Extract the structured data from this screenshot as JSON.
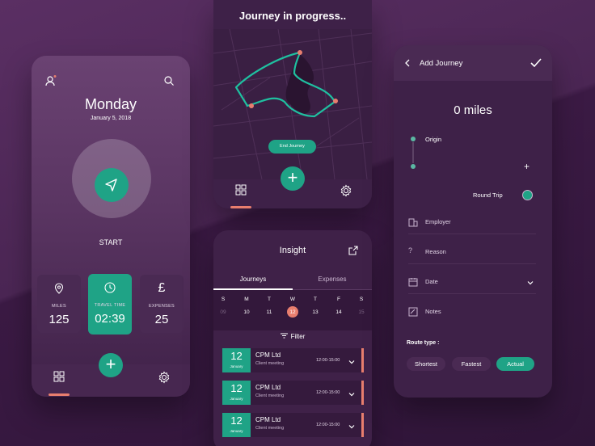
{
  "colors": {
    "accent": "#1fa386",
    "highlight": "#e87e6e",
    "background": "#3a1a42"
  },
  "home": {
    "day": "Monday",
    "date": "January 5, 2018",
    "start_label": "START",
    "stats": [
      {
        "label": "MILES",
        "value": "125",
        "icon": "location-pin-icon"
      },
      {
        "label": "TRAVEL TIME",
        "value": "02:39",
        "icon": "clock-icon"
      },
      {
        "label": "EXPENSES",
        "value": "25",
        "icon": "pound-icon"
      }
    ],
    "add_label": "+"
  },
  "journey": {
    "title": "Journey in progress..",
    "end_button": "End Journey",
    "add_label": "+"
  },
  "insight": {
    "title": "Insight",
    "tabs": [
      "Journeys",
      "Expenses"
    ],
    "day_letters": [
      "S",
      "M",
      "T",
      "W",
      "T",
      "F",
      "S"
    ],
    "day_numbers": [
      "09",
      "10",
      "11",
      "12",
      "13",
      "14",
      "15"
    ],
    "selected_day_index": 3,
    "filter_label": "Filter",
    "trips": [
      {
        "day": "12",
        "month": "January",
        "name": "CPM Ltd",
        "subtitle": "Client meeting",
        "time": "12:00-15:00"
      },
      {
        "day": "12",
        "month": "January",
        "name": "CPM Ltd",
        "subtitle": "Client meeting",
        "time": "12:00-15:00"
      },
      {
        "day": "12",
        "month": "January",
        "name": "CPM Ltd",
        "subtitle": "Client meeting",
        "time": "12:00-15:00"
      }
    ]
  },
  "add_journey": {
    "title": "Add Journey",
    "miles": "0 miles",
    "origin": "Origin",
    "add_stop": "+",
    "round_trip": "Round Trip",
    "fields": [
      {
        "label": "Employer",
        "icon": "building-icon"
      },
      {
        "label": "Reason",
        "icon": "question-icon"
      },
      {
        "label": "Date",
        "icon": "calendar-icon"
      },
      {
        "label": "Notes",
        "icon": "notes-icon"
      }
    ],
    "route_type_label": "Route type :",
    "route_types": [
      "Shortest",
      "Fastest",
      "Actual"
    ],
    "selected_route": "Actual"
  }
}
